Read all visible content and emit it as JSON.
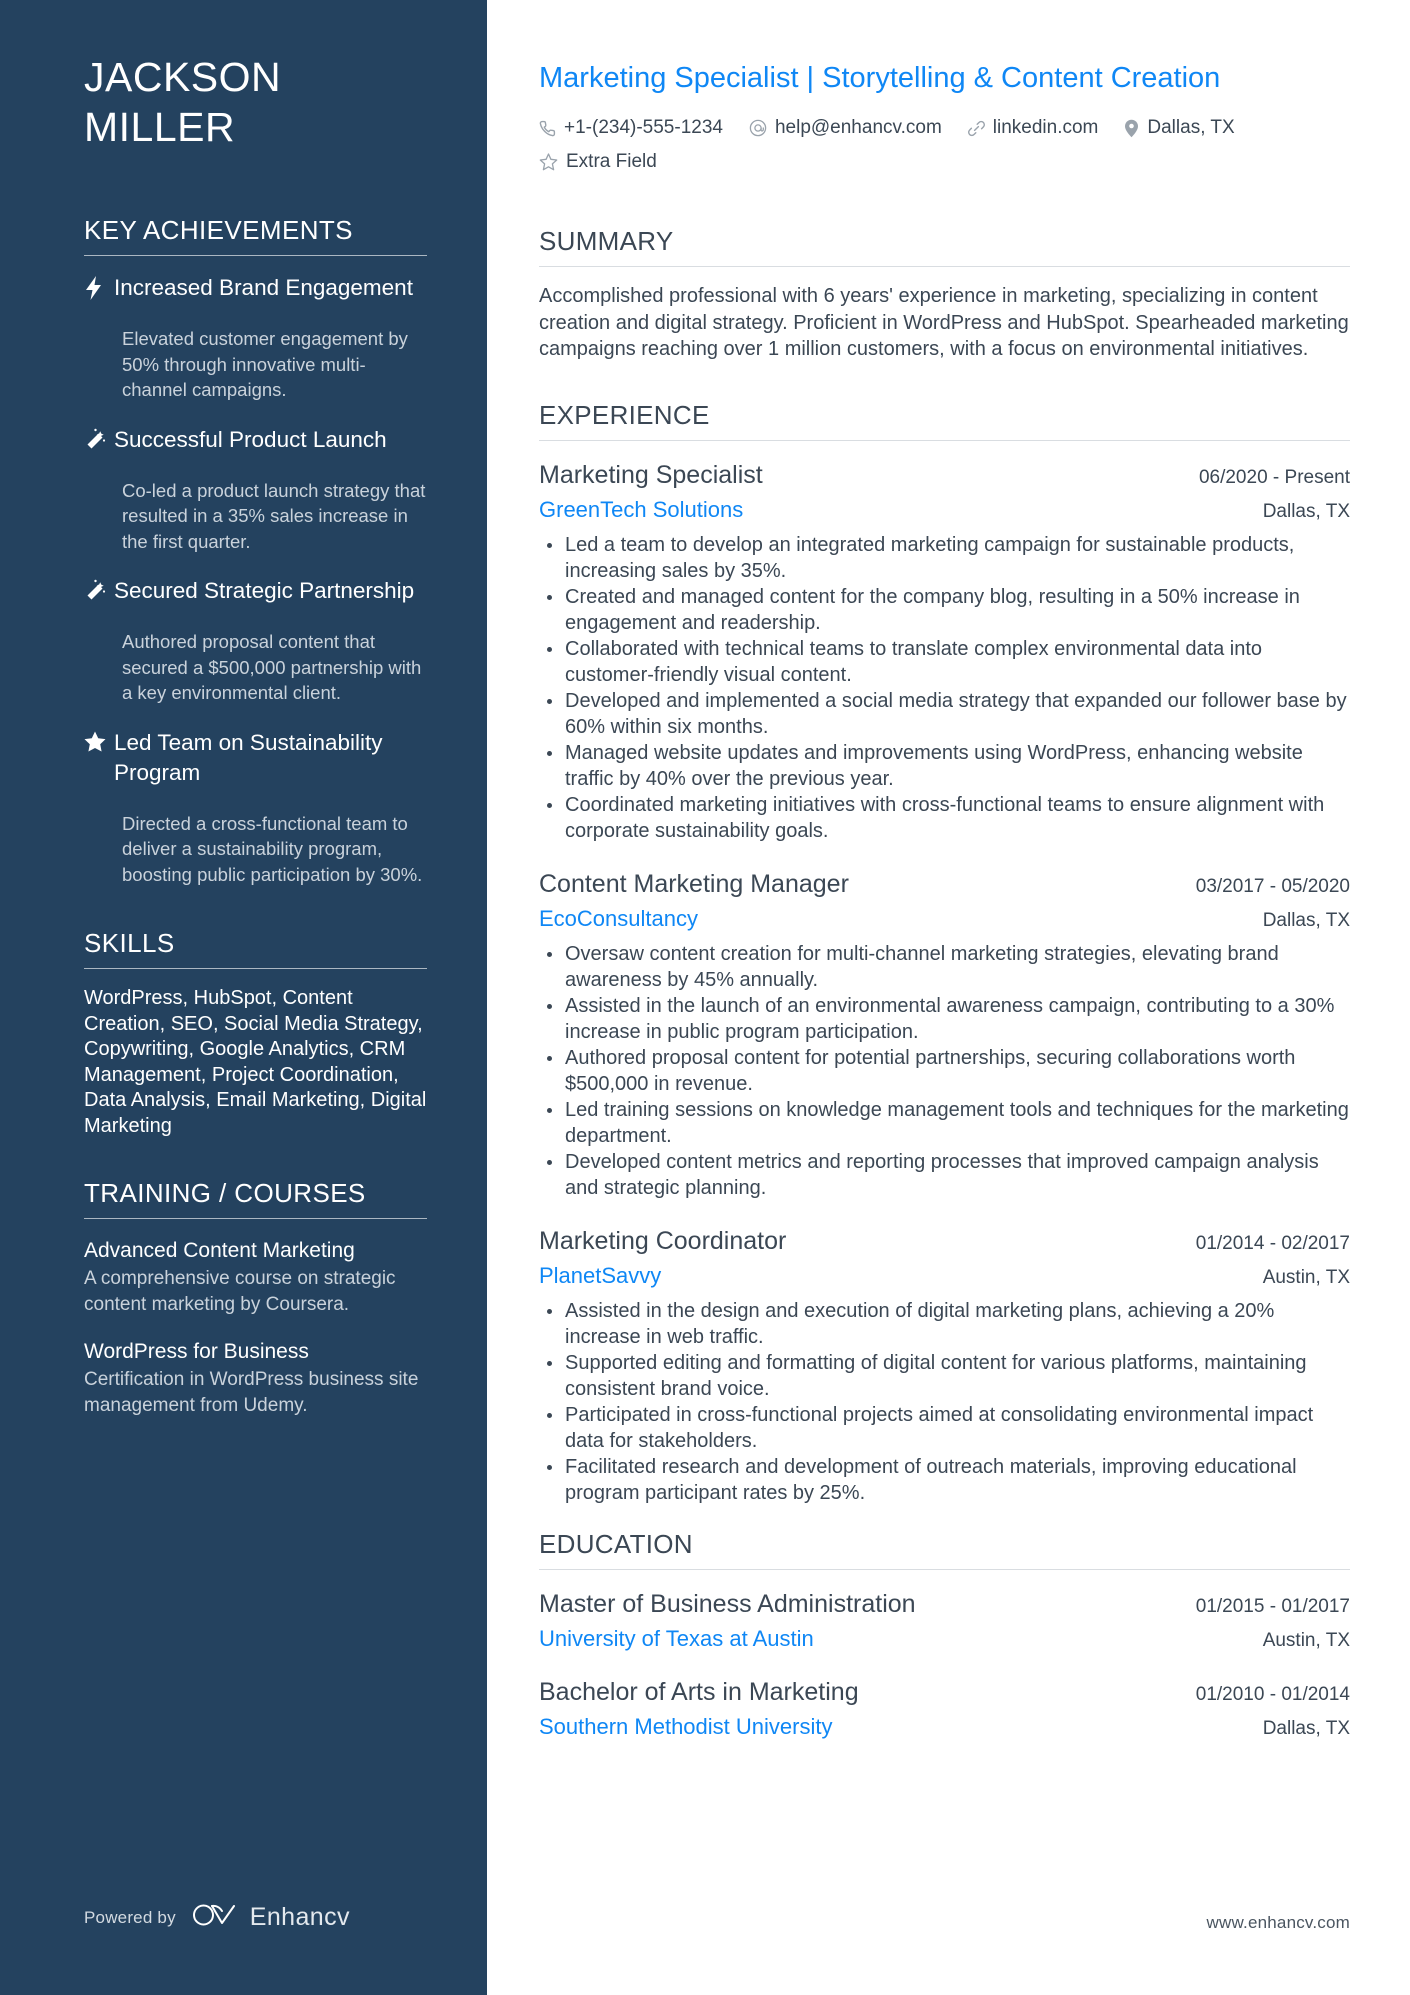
{
  "sidebar": {
    "name_lines": [
      "JACKSON",
      "MILLER"
    ],
    "achievements_heading": "KEY ACHIEVEMENTS",
    "achievements": [
      {
        "icon": "lightning-bolt-icon",
        "title": "Increased Brand Engagement",
        "description": "Elevated customer engagement by 50% through innovative multi-channel campaigns."
      },
      {
        "icon": "magic-wand-icon",
        "title": "Successful Product Launch",
        "description": "Co-led a product launch strategy that resulted in a 35% sales increase in the first quarter."
      },
      {
        "icon": "magic-wand-icon",
        "title": "Secured Strategic Partnership",
        "description": "Authored proposal content that secured a $500,000 partnership with a key environmental client."
      },
      {
        "icon": "star-icon",
        "title": "Led Team on Sustainability Program",
        "description": "Directed a cross-functional team to deliver a sustainability program, boosting public participation by 30%."
      }
    ],
    "skills_heading": "SKILLS",
    "skills_text": "WordPress, HubSpot, Content Creation, SEO, Social Media Strategy, Copywriting, Google Analytics, CRM Management, Project Coordination, Data Analysis, Email Marketing, Digital Marketing",
    "training_heading": "TRAINING / COURSES",
    "courses": [
      {
        "title": "Advanced Content Marketing",
        "description": "A comprehensive course on strategic content marketing by Coursera."
      },
      {
        "title": "WordPress for Business",
        "description": "Certification in WordPress business site management from Udemy."
      }
    ],
    "footer": {
      "powered_by": "Powered by",
      "brand": "Enhancv"
    }
  },
  "main": {
    "headline": "Marketing Specialist | Storytelling & Content Creation",
    "contacts": [
      {
        "icon": "phone-icon",
        "value": "+1-(234)-555-1234"
      },
      {
        "icon": "at-email-icon",
        "value": "help@enhancv.com"
      },
      {
        "icon": "link-icon",
        "value": "linkedin.com"
      },
      {
        "icon": "location-pin-icon",
        "value": "Dallas, TX"
      },
      {
        "icon": "star-outline-icon",
        "value": "Extra Field"
      }
    ],
    "summary_heading": "SUMMARY",
    "summary_text": "Accomplished professional with 6 years' experience in marketing, specializing in content creation and digital strategy. Proficient in WordPress and HubSpot. Spearheaded marketing campaigns reaching over 1 million customers, with a focus on environmental initiatives.",
    "experience_heading": "EXPERIENCE",
    "experience": [
      {
        "title": "Marketing Specialist",
        "dates": "06/2020 - Present",
        "company": "GreenTech Solutions",
        "location": "Dallas, TX",
        "bullets": [
          "Led a team to develop an integrated marketing campaign for sustainable products, increasing sales by 35%.",
          "Created and managed content for the company blog, resulting in a 50% increase in engagement and readership.",
          "Collaborated with technical teams to translate complex environmental data into customer-friendly visual content.",
          "Developed and implemented a social media strategy that expanded our follower base by 60% within six months.",
          "Managed website updates and improvements using WordPress, enhancing website traffic by 40% over the previous year.",
          "Coordinated marketing initiatives with cross-functional teams to ensure alignment with corporate sustainability goals."
        ]
      },
      {
        "title": "Content Marketing Manager",
        "dates": "03/2017 - 05/2020",
        "company": "EcoConsultancy",
        "location": "Dallas, TX",
        "bullets": [
          "Oversaw content creation for multi-channel marketing strategies, elevating brand awareness by 45% annually.",
          "Assisted in the launch of an environmental awareness campaign, contributing to a 30% increase in public program participation.",
          "Authored proposal content for potential partnerships, securing collaborations worth $500,000 in revenue.",
          "Led training sessions on knowledge management tools and techniques for the marketing department.",
          "Developed content metrics and reporting processes that improved campaign analysis and strategic planning."
        ]
      },
      {
        "title": "Marketing Coordinator",
        "dates": "01/2014 - 02/2017",
        "company": "PlanetSavvy",
        "location": "Austin, TX",
        "bullets": [
          "Assisted in the design and execution of digital marketing plans, achieving a 20% increase in web traffic.",
          "Supported editing and formatting of digital content for various platforms, maintaining consistent brand voice.",
          "Participated in cross-functional projects aimed at consolidating environmental impact data for stakeholders.",
          "Facilitated research and development of outreach materials, improving educational program participant rates by 25%."
        ]
      }
    ],
    "education_heading": "EDUCATION",
    "education": [
      {
        "degree": "Master of Business Administration",
        "dates": "01/2015 - 01/2017",
        "school": "University of Texas at Austin",
        "location": "Austin, TX"
      },
      {
        "degree": "Bachelor of Arts in Marketing",
        "dates": "01/2010 - 01/2014",
        "school": "Southern Methodist University",
        "location": "Dallas, TX"
      }
    ],
    "footer_url": "www.enhancv.com"
  },
  "colors": {
    "sidebar_bg": "#24425f",
    "accent_blue": "#0f87f5",
    "body_text": "#3b4754",
    "sidebar_muted": "#c9d2db"
  }
}
